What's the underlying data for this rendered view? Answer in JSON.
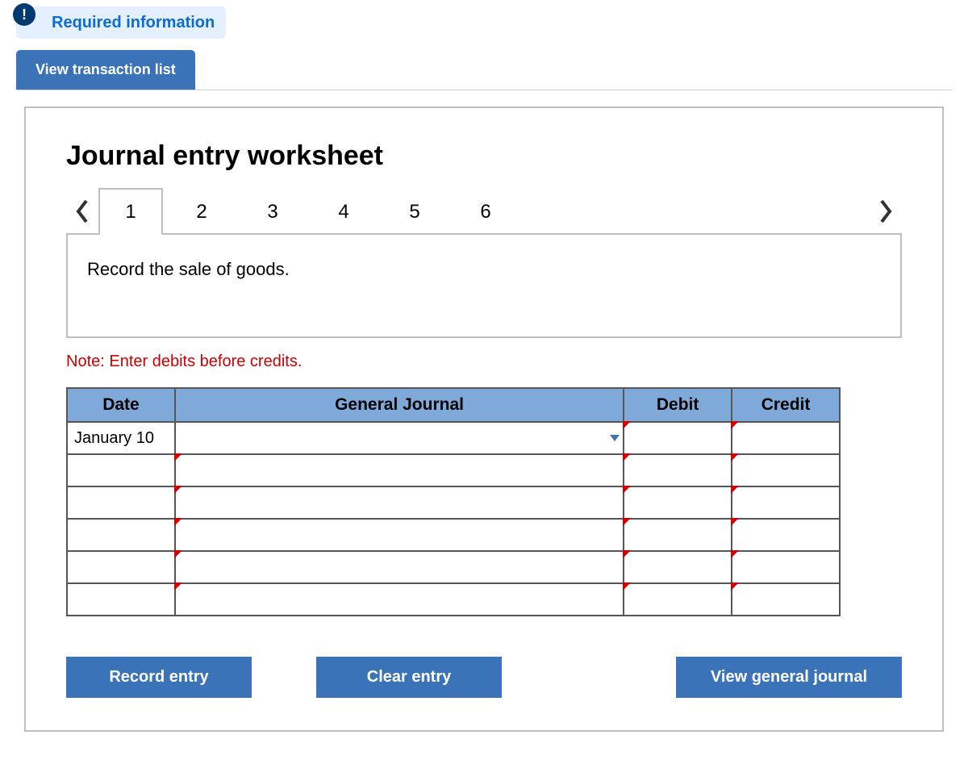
{
  "header": {
    "info_icon": "!",
    "info_label": "Required information",
    "view_tab": "View transaction list"
  },
  "worksheet": {
    "title": "Journal entry worksheet",
    "tabs": [
      "1",
      "2",
      "3",
      "4",
      "5",
      "6"
    ],
    "active_tab_index": 0,
    "instruction": "Record the sale of goods.",
    "note": "Note: Enter debits before credits.",
    "columns": {
      "date": "Date",
      "gj": "General Journal",
      "debit": "Debit",
      "credit": "Credit"
    },
    "rows": [
      {
        "date": "January 10",
        "gj": "",
        "debit": "",
        "credit": ""
      },
      {
        "date": "",
        "gj": "",
        "debit": "",
        "credit": ""
      },
      {
        "date": "",
        "gj": "",
        "debit": "",
        "credit": ""
      },
      {
        "date": "",
        "gj": "",
        "debit": "",
        "credit": ""
      },
      {
        "date": "",
        "gj": "",
        "debit": "",
        "credit": ""
      },
      {
        "date": "",
        "gj": "",
        "debit": "",
        "credit": ""
      }
    ],
    "buttons": {
      "record": "Record entry",
      "clear": "Clear entry",
      "view_gj": "View general journal"
    }
  }
}
